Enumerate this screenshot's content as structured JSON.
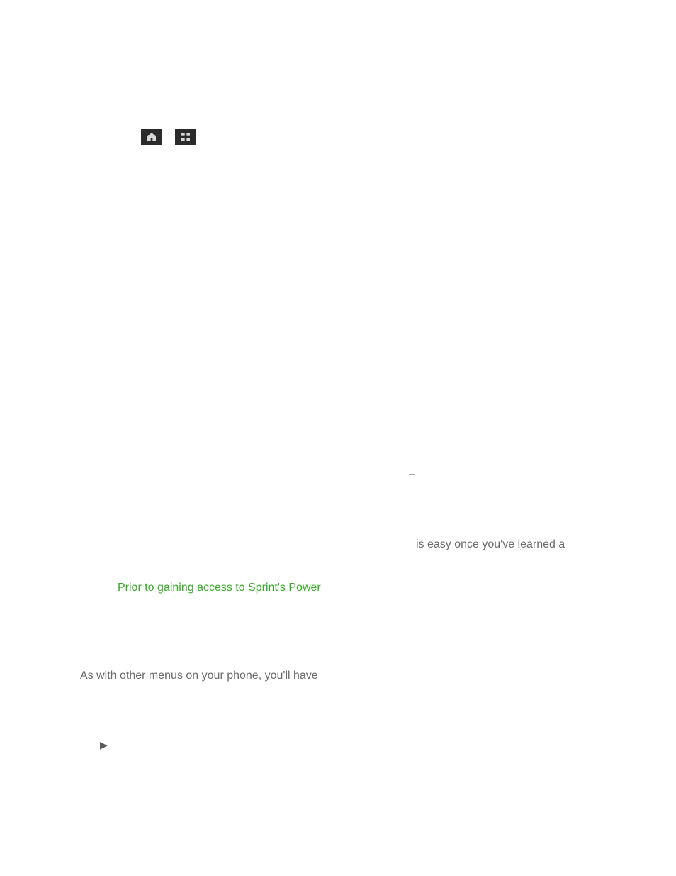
{
  "icons": {
    "home": "home-icon",
    "apps": "apps-icon"
  },
  "fragments": {
    "dash": "–",
    "easy_once": " is easy once you've learned a",
    "prior_to": "Prior to gaining access to Sprint's Power",
    "as_with": "As with other menus on your phone, you'll have",
    "arrow": "▶"
  }
}
